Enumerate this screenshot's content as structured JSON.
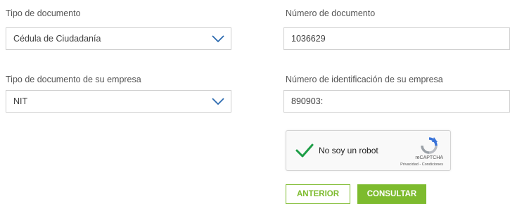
{
  "form": {
    "doc_type_label": "Tipo de documento",
    "doc_type_value": "Cédula de Ciudadanía",
    "doc_number_label": "Número de documento",
    "doc_number_value": "1036629",
    "company_doc_type_label": "Tipo de documento de su empresa",
    "company_doc_type_value": "NIT",
    "company_id_label": "Número de identificación de su empresa",
    "company_id_value": "890903:"
  },
  "captcha": {
    "label": "No soy un robot",
    "brand": "reCAPTCHA",
    "links": "Privacidad - Condiciones",
    "check_icon": "checkmark-icon",
    "logo_icon": "recaptcha-logo-icon"
  },
  "buttons": {
    "prev_label": "ANTERIOR",
    "next_label": "CONSULTAR"
  },
  "colors": {
    "accent": "#7dbb2e",
    "chevron": "#2b6ab0"
  }
}
